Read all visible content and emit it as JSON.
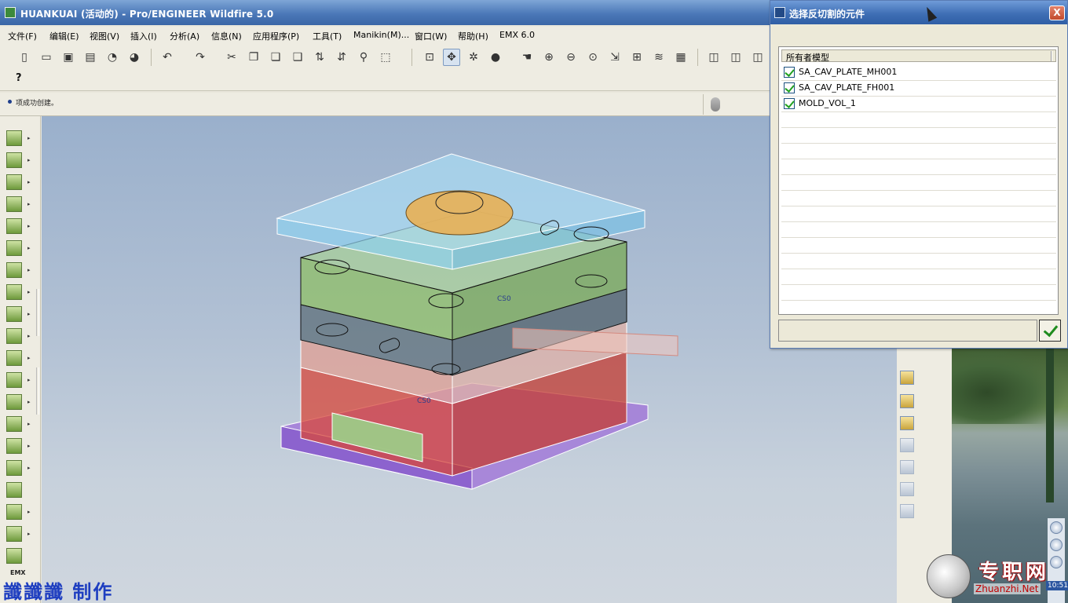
{
  "window": {
    "title": "HUANKUAI (活动的) - Pro/ENGINEER Wildfire 5.0"
  },
  "menu": [
    "文件(F)",
    "编辑(E)",
    "视图(V)",
    "插入(I)",
    "分析(A)",
    "信息(N)",
    "应用程序(P)",
    "工具(T)",
    "Manikin(M)...",
    "窗口(W)",
    "帮助(H)",
    "EMX 6.0"
  ],
  "toolbar": {
    "buttons": [
      "new-icon",
      "open-icon",
      "save-icon",
      "print-icon",
      "send-icon",
      "mail-icon",
      "undo-icon",
      "redo-icon",
      "cut-icon",
      "copy-icon",
      "paste-icon",
      "paste-special-icon",
      "regenerate-icon",
      "regen-manager-icon",
      "find-icon",
      "select-box-icon",
      "datum-display-icon",
      "spin-center-icon",
      "orient-icon",
      "shading-icon",
      "pan-icon",
      "zoom-in-icon",
      "zoom-out-icon",
      "refit-icon",
      "insert-icon",
      "annotation-icon",
      "layers-icon",
      "view-manager-icon",
      "view-front-icon",
      "view-back-icon",
      "view-right-icon"
    ],
    "whats_this": "?"
  },
  "message": {
    "text": "项成功创建。"
  },
  "lefttools": {
    "count": 21,
    "emx_label": "EMX"
  },
  "dialog": {
    "title": "选择反切割的元件",
    "column_header": "所有者模型",
    "models": [
      {
        "name": "SA_CAV_PLATE_MH001",
        "checked": true
      },
      {
        "name": "SA_CAV_PLATE_FH001",
        "checked": true
      },
      {
        "name": "MOLD_VOL_1",
        "checked": true
      }
    ],
    "close_label": "X"
  },
  "viewport": {
    "labels": [
      "CS0",
      "CS0"
    ],
    "colors": {
      "top_plate": "#8fd1f0",
      "a_plate": "#8fbf66",
      "b_plate": "#5e6f7a",
      "support": "#e3a093",
      "spacer": "#d8473a",
      "bottom_plate": "#a27ad8",
      "locating_ring": "#e8b055"
    }
  },
  "watermarks": {
    "left": "讖讖讖 制作",
    "logo_cn": "专职网",
    "logo_url": "Zhuanzhi.Net",
    "clock": "10:51"
  }
}
